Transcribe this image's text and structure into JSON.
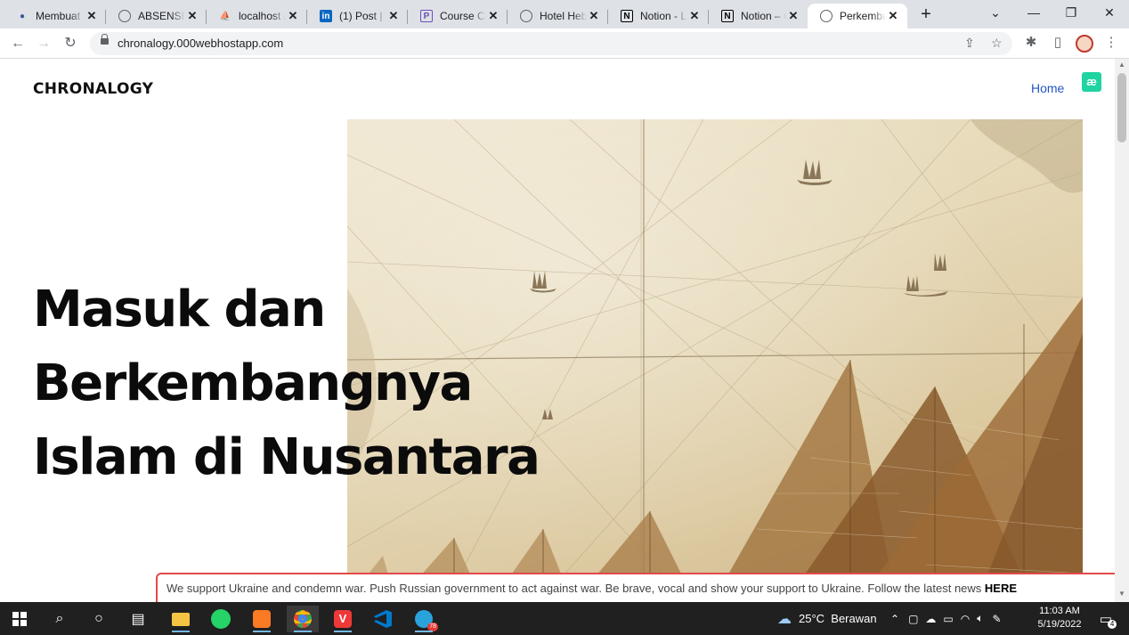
{
  "browser": {
    "tabs": [
      {
        "title": "Membuat",
        "icon": "profile-icon",
        "color": "#3b5998"
      },
      {
        "title": "ABSENSI W",
        "icon": "globe-icon",
        "color": "#5f6368"
      },
      {
        "title": "localhost /",
        "icon": "phpmyadmin-icon",
        "color": "#f29111"
      },
      {
        "title": "(1) Post | F",
        "icon": "linkedin-icon",
        "color": "#0a66c2"
      },
      {
        "title": "Course Co",
        "icon": "course-icon",
        "color": "#6b4fbb"
      },
      {
        "title": "Hotel Heb",
        "icon": "globe-icon",
        "color": "#5f6368"
      },
      {
        "title": "Notion - L",
        "icon": "notion-icon",
        "color": "#000000"
      },
      {
        "title": "Notion – C",
        "icon": "notion-icon",
        "color": "#000000"
      },
      {
        "title": "Perkemba",
        "icon": "globe-icon",
        "color": "#5f6368"
      }
    ],
    "active_tab": 8,
    "url": "chronalogy.000webhostapp.com"
  },
  "site": {
    "brand": "CHRONALOGY",
    "nav": {
      "home": "Home",
      "badge": "æ"
    },
    "hero": {
      "line1": "Masuk dan",
      "line2": "Berkembangnya",
      "line3": "Islam di Nusantara"
    },
    "banner": {
      "text": "We support Ukraine and condemn war. Push Russian government to act against war. Be brave, vocal and show your support to Ukraine. Follow the latest news ",
      "link": "HERE"
    }
  },
  "taskbar": {
    "apps": [
      "start-icon",
      "search-icon",
      "cortana-icon",
      "task-view-icon",
      "file-explorer-icon",
      "whatsapp-icon",
      "xampp-icon",
      "chrome-icon",
      "vivaldi-icon",
      "vscode-icon",
      "telegram-icon"
    ],
    "weather": "25°C  Berawan",
    "time": "11:03 AM",
    "date": "5/19/2022",
    "telegram_badge": "78",
    "notifications": "4"
  }
}
